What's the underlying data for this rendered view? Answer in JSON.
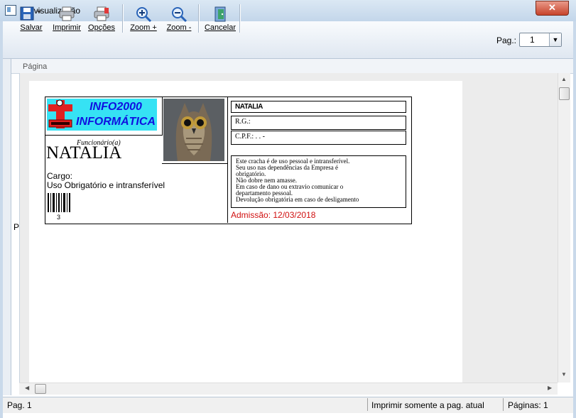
{
  "window": {
    "title": "Prévisualização",
    "close_glyph": "✕"
  },
  "toolbar": {
    "save_label": "Salvar",
    "print_label": "Imprimir",
    "options_label": "Opções",
    "zoom_in_label": "Zoom +",
    "zoom_out_label": "Zoom -",
    "cancel_label": "Cancelar",
    "page_label": "Pag.:",
    "page_value": "1"
  },
  "preview": {
    "header_label": "Página",
    "side_marker": "P"
  },
  "badge": {
    "logo_line1": "INFO2000",
    "logo_line2": "INFORMÁTICA",
    "employee_label": "Funcionário(a)",
    "employee_name": "NATALIA",
    "cargo_label": "Cargo:",
    "cargo_value": "Uso Obrigatório e intransferível",
    "barcode_number": "3",
    "name_field": "NATALIA",
    "rg_field": "R.G.:",
    "cpf_field": "C.P.F.:   .   .   -",
    "notice_lines": [
      "Este cracha é de uso pessoal e intransferível.",
      "Seu uso nas dependências da Empresa é",
      "obrigatório.",
      "Não dobre nem amasse.",
      "Em caso de dano ou extravio comunicar o",
      "departamento pessoal.",
      "Devolução obrigatória em caso de desligamento"
    ],
    "admission": "Admissão: 12/03/2018"
  },
  "statusbar": {
    "page": "Pag. 1",
    "print_mode": "Imprimir somente a pag. atual",
    "pages": "Páginas: 1"
  }
}
